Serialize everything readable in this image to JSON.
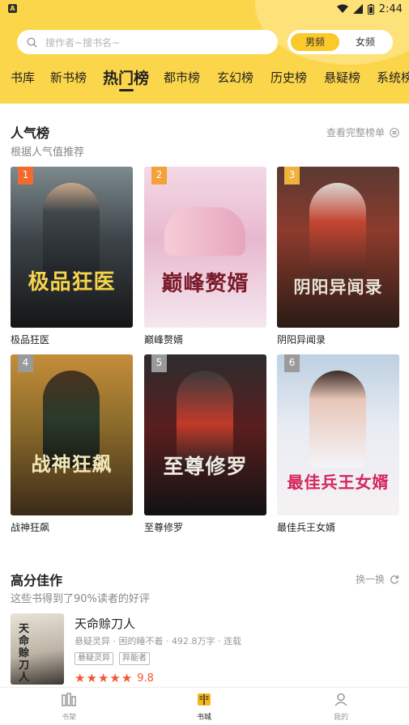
{
  "status": {
    "time": "2:44",
    "app_icon": "A"
  },
  "search": {
    "placeholder": "搜作者~搜书名~"
  },
  "gender_toggle": {
    "options": [
      "男频",
      "女频"
    ],
    "selected": "男频"
  },
  "tabs": [
    "书库",
    "新书榜",
    "热门榜",
    "都市榜",
    "玄幻榜",
    "历史榜",
    "悬疑榜",
    "系统榜"
  ],
  "active_tab": "热门榜",
  "popular": {
    "title": "人气榜",
    "subtitle": "根据人气值推荐",
    "link": "查看完整榜单",
    "books": [
      {
        "rank": "1",
        "name": "极品狂医",
        "cover_text": "极品狂医"
      },
      {
        "rank": "2",
        "name": "巅峰赘婿",
        "cover_text": "巅峰赘婿"
      },
      {
        "rank": "3",
        "name": "阴阳异闻录",
        "cover_text": "阴阳异闻录"
      },
      {
        "rank": "4",
        "name": "战神狂飙",
        "cover_text": "战神狂飙"
      },
      {
        "rank": "5",
        "name": "至尊修罗",
        "cover_text": "至尊修罗"
      },
      {
        "rank": "6",
        "name": "最佳兵王女婿",
        "cover_text": "最佳兵王女婿"
      }
    ]
  },
  "high_score": {
    "title": "高分佳作",
    "subtitle": "这些书得到了90%读者的好评",
    "link": "换一换",
    "book": {
      "title": "天命赊刀人",
      "cover_text": "天命赊刀人",
      "meta": "悬疑灵异 · 困的睡不着 · 492.8万字 · 连载",
      "tags": [
        "悬疑灵异",
        "异能者"
      ],
      "rating": "9.8",
      "stars": 5
    }
  },
  "bottom_nav": [
    {
      "label": "书架",
      "icon": "bookshelf-icon"
    },
    {
      "label": "书城",
      "icon": "bookstore-icon"
    },
    {
      "label": "我的",
      "icon": "profile-icon"
    }
  ],
  "bottom_nav_active": "书城",
  "colors": {
    "accent": "#fcd64a",
    "star": "#f2572d"
  }
}
